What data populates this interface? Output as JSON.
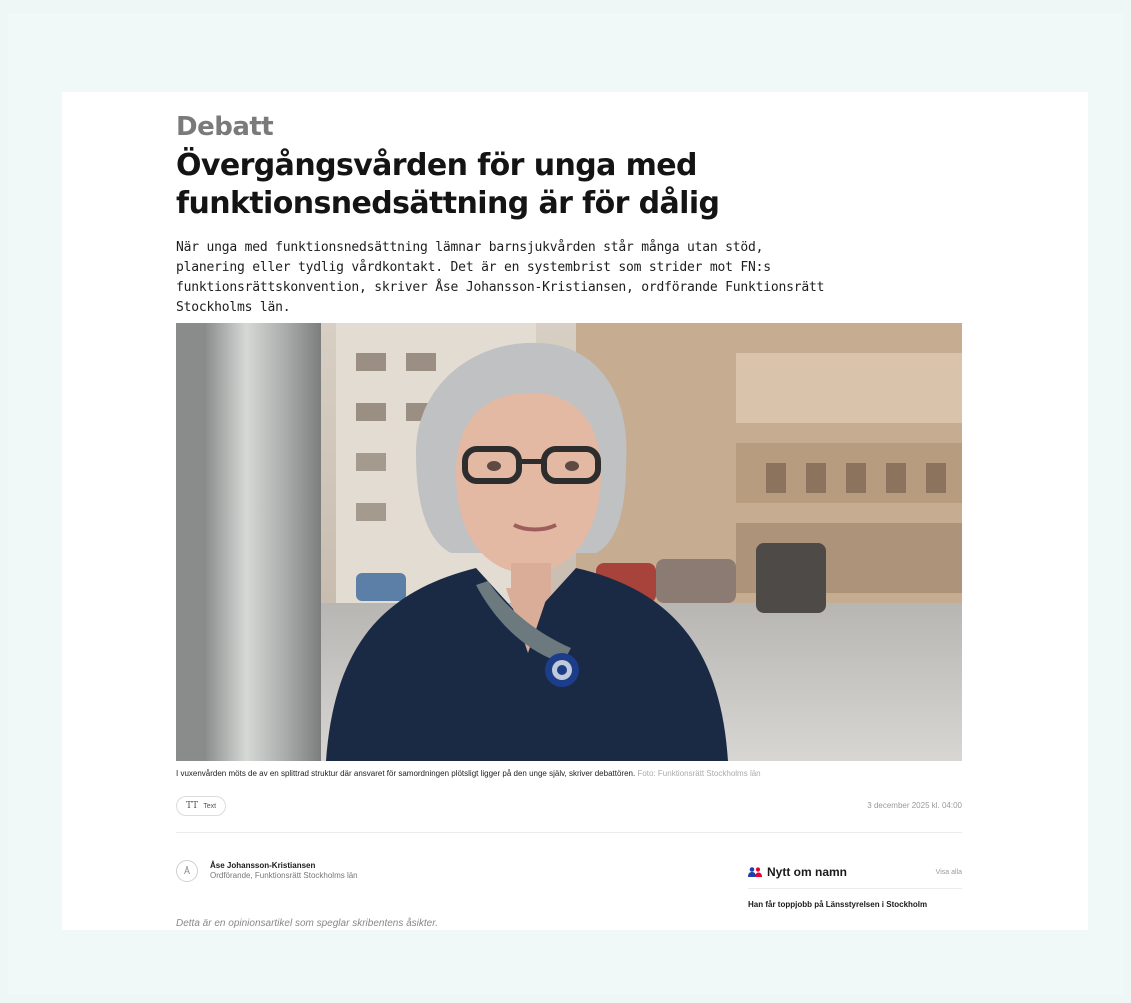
{
  "article": {
    "section": "Debatt",
    "headline": "Övergångsvården för unga med funktionsnedsättning är för dålig",
    "lead": "När unga med funktionsnedsättning lämnar barnsjukvården står många utan stöd, planering eller tydlig vårdkontakt. Det är en systembrist som strider mot FN:s funktionsrättskonvention, skriver Åse Johansson-Kristiansen, ordförande Funktionsrätt Stockholms län.",
    "caption": "I vuxenvården möts de av en splittrad struktur där ansvaret för samordningen plötsligt ligger på den unge själv, skriver debattören.",
    "photo_credit": "Foto: Funktionsrätt Stockholms län",
    "text_button_icon": "TT",
    "text_button_label": "Text",
    "date": "3 december 2025 kl. 04:00",
    "author": {
      "initial": "Å",
      "name": "Åse Johansson-Kristiansen",
      "role": "Ordförande, Funktionsrätt Stockholms län"
    },
    "disclaimer": "Detta är en opinionsartikel som speglar skribentens åsikter."
  },
  "sidebar": {
    "title": "Nytt om namn",
    "link": "Visa alla",
    "items": [
      "Han får toppjobb på Länsstyrelsen i Stockholm"
    ]
  },
  "colors": {
    "page_background": "#eef6f6",
    "accent_icon": "#e3003b",
    "accent_icon_2": "#1d3fa8"
  }
}
